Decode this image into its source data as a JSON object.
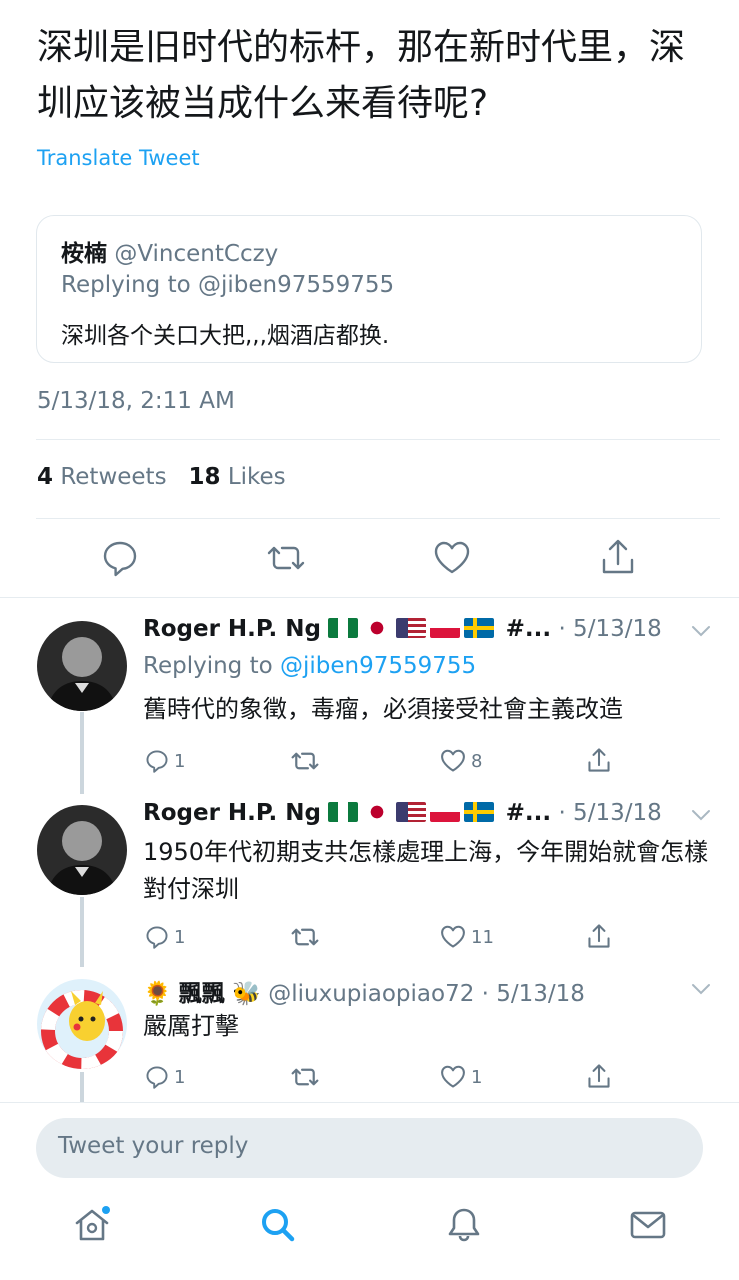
{
  "tweet": {
    "text": "深圳是旧时代的标杆，那在新时代里，深圳应该被当成什么来看待呢?",
    "translate_label": "Translate Tweet",
    "quoted": {
      "name": "桉楠",
      "handle": "@VincentCczy",
      "replying_prefix": "Replying to ",
      "replying_handle": "@jiben97559755",
      "text": "深圳各个关口大把,,,烟酒店都换."
    },
    "timestamp": "5/13/18, 2:11 AM",
    "retweets_count": "4",
    "retweets_label": "Retweets",
    "likes_count": "18",
    "likes_label": "Likes"
  },
  "replies": [
    {
      "name": "Roger H.P. Ng",
      "name_suffix": "#...",
      "dot_date": "· 5/13/18",
      "replying_prefix": "Replying to ",
      "replying_handle": "@jiben97559755",
      "text": "舊時代的象徵，毒瘤，必須接受社會主義改造",
      "reply_count": "1",
      "like_count": "8"
    },
    {
      "name": "Roger H.P. Ng",
      "name_suffix": "#...",
      "dot_date": "· 5/13/18",
      "text": "1950年代初期支共怎樣處理上海，今年開始就會怎樣對付深圳",
      "reply_count": "1",
      "like_count": "11"
    },
    {
      "name": "飄飄",
      "handle_date": "@liuxupiaopiao72 · 5/13/18",
      "text": "嚴厲打擊",
      "reply_count": "1",
      "like_count": "1"
    }
  ],
  "composer": {
    "placeholder": "Tweet your reply"
  },
  "icons": {
    "reply": "reply-icon",
    "retweet": "retweet-icon",
    "like": "heart-icon",
    "share": "share-icon",
    "chevron": "chevron-down-icon",
    "home": "home-icon",
    "search": "search-icon",
    "notifications": "bell-icon",
    "messages": "mail-icon"
  },
  "colors": {
    "accent": "#1da1f2",
    "muted": "#657786",
    "text": "#14171a",
    "divider": "#e6ecf0"
  }
}
